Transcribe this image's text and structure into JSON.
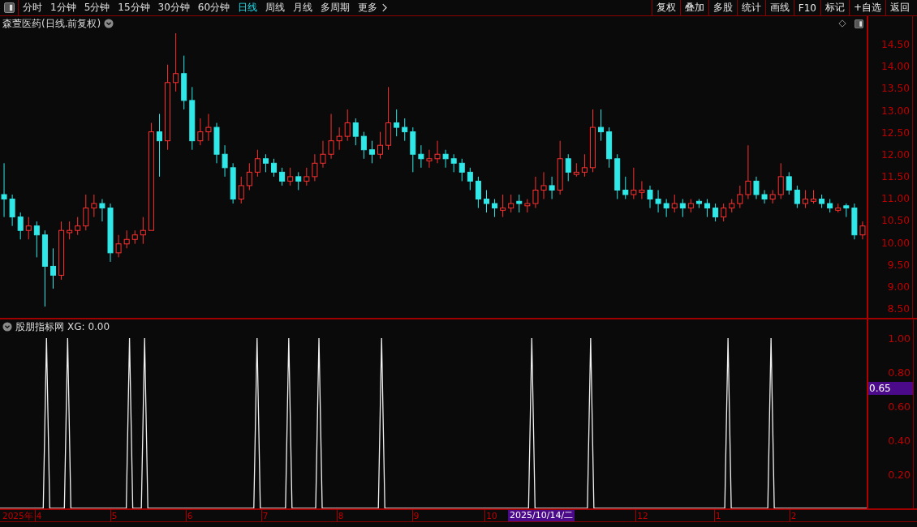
{
  "toolbar": {
    "periods": [
      {
        "label": "分时",
        "selected": false
      },
      {
        "label": "1分钟",
        "selected": false
      },
      {
        "label": "5分钟",
        "selected": false
      },
      {
        "label": "15分钟",
        "selected": false
      },
      {
        "label": "30分钟",
        "selected": false
      },
      {
        "label": "60分钟",
        "selected": false
      },
      {
        "label": "日线",
        "selected": true
      },
      {
        "label": "周线",
        "selected": false
      },
      {
        "label": "月线",
        "selected": false
      },
      {
        "label": "多周期",
        "selected": false
      }
    ],
    "more": "更多",
    "buttons": [
      "复权",
      "叠加",
      "多股",
      "统计",
      "画线",
      "F10",
      "标记",
      "+自选",
      "返回"
    ]
  },
  "price_panel": {
    "title": "森萱医药(日线.前复权)",
    "chart_data": {
      "type": "candlestick",
      "ylim": [
        8.35,
        15.08
      ],
      "yticks": [
        {
          "value": 14.5,
          "label": "14.50"
        },
        {
          "value": 14,
          "label": "14.00"
        },
        {
          "value": 13.5,
          "label": "13.50"
        },
        {
          "value": 13,
          "label": "13.00"
        },
        {
          "value": 12.5,
          "label": "12.50"
        },
        {
          "value": 12,
          "label": "12.00"
        },
        {
          "value": 11.5,
          "label": "11.50"
        },
        {
          "value": 11,
          "label": "11.00"
        },
        {
          "value": 10.5,
          "label": "10.50"
        },
        {
          "value": 10,
          "label": "10.00"
        },
        {
          "value": 9.5,
          "label": "9.50"
        },
        {
          "value": 9,
          "label": "9.00"
        },
        {
          "value": 8.5,
          "label": "8.50"
        }
      ],
      "categories": [
        null,
        null,
        null,
        null,
        null,
        null,
        null,
        null,
        null,
        null,
        null,
        null,
        null,
        null,
        null,
        null,
        null,
        null,
        null,
        null,
        null,
        null,
        null,
        null,
        null,
        null,
        null,
        null,
        null,
        null,
        null,
        null,
        null,
        null,
        null,
        null,
        null,
        null,
        null,
        null,
        null,
        null,
        null,
        null,
        null,
        null,
        null,
        null,
        null,
        null,
        null,
        null,
        null,
        null,
        null,
        null,
        null,
        null,
        null,
        null,
        null,
        null,
        null,
        null,
        null,
        null,
        null,
        null,
        null,
        null,
        null,
        null,
        null,
        null,
        null,
        null,
        null,
        null,
        null,
        null,
        null,
        null,
        null,
        null,
        null,
        null,
        null,
        null,
        null,
        null,
        null,
        null,
        null,
        null,
        null,
        null,
        null,
        null,
        null,
        null,
        null,
        null,
        null,
        null,
        null,
        null
      ],
      "ohlc": [
        [
          11.1,
          11.8,
          10.6,
          11.0
        ],
        [
          11.0,
          11.1,
          10.4,
          10.6
        ],
        [
          10.6,
          10.7,
          10.1,
          10.3
        ],
        [
          10.3,
          10.6,
          10.1,
          10.4
        ],
        [
          10.4,
          10.5,
          9.7,
          10.2
        ],
        [
          10.2,
          10.3,
          8.6,
          9.5
        ],
        [
          9.5,
          9.9,
          9.0,
          9.3
        ],
        [
          9.3,
          10.5,
          9.2,
          10.3
        ],
        [
          10.25,
          10.5,
          10.1,
          10.3
        ],
        [
          10.3,
          10.6,
          10.2,
          10.4
        ],
        [
          10.4,
          11.1,
          10.3,
          10.8
        ],
        [
          10.8,
          11.1,
          10.6,
          10.9
        ],
        [
          10.9,
          11.0,
          10.5,
          10.8
        ],
        [
          10.8,
          10.9,
          9.6,
          9.8
        ],
        [
          9.8,
          10.2,
          9.7,
          10.0
        ],
        [
          10.0,
          10.3,
          9.9,
          10.1
        ],
        [
          10.1,
          10.3,
          10.0,
          10.2
        ],
        [
          10.2,
          10.6,
          10.0,
          10.3
        ],
        [
          10.3,
          12.7,
          10.3,
          12.5
        ],
        [
          12.5,
          12.9,
          11.5,
          12.3
        ],
        [
          12.3,
          14.0,
          12.1,
          13.6
        ],
        [
          13.6,
          14.7,
          13.4,
          13.8
        ],
        [
          13.8,
          14.2,
          13.0,
          13.2
        ],
        [
          13.2,
          13.5,
          12.1,
          12.3
        ],
        [
          12.3,
          12.8,
          12.2,
          12.5
        ],
        [
          12.5,
          12.9,
          12.3,
          12.6
        ],
        [
          12.6,
          12.7,
          11.8,
          12.0
        ],
        [
          12.0,
          12.2,
          11.5,
          11.7
        ],
        [
          11.7,
          11.8,
          10.9,
          11.0
        ],
        [
          11.0,
          11.5,
          10.9,
          11.3
        ],
        [
          11.3,
          11.8,
          11.2,
          11.6
        ],
        [
          11.6,
          12.1,
          11.5,
          11.9
        ],
        [
          11.9,
          12.0,
          11.6,
          11.8
        ],
        [
          11.8,
          11.9,
          11.5,
          11.6
        ],
        [
          11.6,
          11.7,
          11.3,
          11.4
        ],
        [
          11.4,
          11.7,
          11.3,
          11.5
        ],
        [
          11.5,
          11.6,
          11.2,
          11.4
        ],
        [
          11.4,
          11.7,
          11.3,
          11.5
        ],
        [
          11.5,
          12.0,
          11.4,
          11.8
        ],
        [
          11.8,
          12.3,
          11.7,
          12.0
        ],
        [
          12.0,
          12.9,
          11.9,
          12.3
        ],
        [
          12.3,
          12.6,
          12.1,
          12.4
        ],
        [
          12.4,
          13.0,
          12.3,
          12.7
        ],
        [
          12.7,
          12.8,
          12.2,
          12.4
        ],
        [
          12.4,
          12.5,
          11.9,
          12.1
        ],
        [
          12.1,
          12.3,
          11.8,
          12.0
        ],
        [
          12.0,
          12.5,
          11.9,
          12.2
        ],
        [
          12.2,
          13.5,
          12.1,
          12.7
        ],
        [
          12.7,
          13.0,
          12.4,
          12.6
        ],
        [
          12.6,
          12.8,
          12.3,
          12.5
        ],
        [
          12.5,
          12.6,
          11.6,
          12.0
        ],
        [
          12.0,
          12.2,
          11.7,
          11.9
        ],
        [
          11.85,
          12.1,
          11.7,
          11.9
        ],
        [
          11.9,
          12.3,
          11.8,
          12.0
        ],
        [
          12.0,
          12.1,
          11.7,
          11.9
        ],
        [
          11.9,
          12.0,
          11.6,
          11.8
        ],
        [
          11.8,
          11.9,
          11.4,
          11.6
        ],
        [
          11.6,
          11.7,
          11.2,
          11.4
        ],
        [
          11.4,
          11.5,
          10.8,
          11.0
        ],
        [
          11.0,
          11.2,
          10.7,
          10.9
        ],
        [
          10.9,
          11.0,
          10.6,
          10.8
        ],
        [
          10.75,
          11.1,
          10.6,
          10.8
        ],
        [
          10.8,
          11.1,
          10.7,
          10.9
        ],
        [
          10.95,
          11.1,
          10.7,
          10.9
        ],
        [
          10.85,
          11.0,
          10.7,
          10.9
        ],
        [
          10.9,
          11.5,
          10.8,
          11.2
        ],
        [
          11.2,
          11.6,
          11.0,
          11.3
        ],
        [
          11.3,
          11.5,
          11.0,
          11.2
        ],
        [
          11.2,
          12.3,
          11.1,
          11.9
        ],
        [
          11.9,
          12.0,
          11.4,
          11.6
        ],
        [
          11.55,
          11.8,
          11.5,
          11.6
        ],
        [
          11.6,
          12.0,
          11.5,
          11.7
        ],
        [
          11.7,
          13.0,
          11.6,
          12.6
        ],
        [
          12.6,
          13.0,
          12.3,
          12.5
        ],
        [
          12.5,
          12.6,
          11.7,
          11.9
        ],
        [
          11.9,
          12.0,
          11.0,
          11.2
        ],
        [
          11.2,
          11.5,
          11.0,
          11.1
        ],
        [
          11.1,
          11.7,
          11.0,
          11.2
        ],
        [
          11.15,
          11.4,
          11.0,
          11.2
        ],
        [
          11.2,
          11.3,
          10.8,
          11.0
        ],
        [
          11.0,
          11.2,
          10.7,
          10.9
        ],
        [
          10.9,
          11.0,
          10.6,
          10.8
        ],
        [
          10.8,
          11.1,
          10.7,
          10.9
        ],
        [
          10.9,
          11.0,
          10.6,
          10.8
        ],
        [
          10.8,
          11.0,
          10.7,
          10.9
        ],
        [
          10.95,
          11.0,
          10.8,
          10.9
        ],
        [
          10.9,
          11.0,
          10.6,
          10.8
        ],
        [
          10.8,
          10.9,
          10.5,
          10.6
        ],
        [
          10.6,
          10.9,
          10.5,
          10.8
        ],
        [
          10.8,
          11.0,
          10.7,
          10.9
        ],
        [
          10.9,
          11.3,
          10.8,
          11.1
        ],
        [
          11.1,
          12.2,
          11.0,
          11.4
        ],
        [
          11.4,
          11.5,
          11.0,
          11.1
        ],
        [
          11.1,
          11.2,
          10.9,
          11.0
        ],
        [
          11.0,
          11.2,
          10.9,
          11.1
        ],
        [
          11.1,
          11.8,
          11.0,
          11.5
        ],
        [
          11.5,
          11.6,
          11.1,
          11.2
        ],
        [
          11.2,
          11.3,
          10.8,
          10.9
        ],
        [
          10.9,
          11.2,
          10.8,
          11.0
        ],
        [
          10.95,
          11.2,
          10.9,
          11.0
        ],
        [
          11.0,
          11.1,
          10.8,
          10.9
        ],
        [
          10.9,
          11.0,
          10.7,
          10.8
        ],
        [
          10.75,
          10.9,
          10.7,
          10.8
        ],
        [
          10.85,
          10.9,
          10.6,
          10.8
        ],
        [
          10.8,
          10.9,
          10.1,
          10.2
        ],
        [
          10.2,
          10.5,
          10.1,
          10.4
        ]
      ]
    }
  },
  "indicator_panel": {
    "name": "股朋指标网",
    "reading": "XG: 0.00",
    "chart_data": {
      "type": "line",
      "xlim": [
        3.484,
        15.634
      ],
      "ylim": [
        0,
        1.11
      ],
      "x": [
        3.484,
        4.057,
        4.1,
        4.143,
        4.337,
        4.38,
        4.423,
        5.157,
        5.2,
        5.243,
        5.357,
        5.4,
        5.443,
        6.847,
        6.89,
        6.933,
        7.267,
        7.31,
        7.353,
        7.667,
        7.71,
        7.753,
        8.497,
        8.54,
        8.583,
        10.487,
        10.53,
        10.573,
        11.267,
        11.31,
        11.353,
        13.087,
        13.13,
        13.173,
        13.657,
        13.7,
        13.743,
        14.968
      ],
      "values": [
        0,
        0,
        1,
        0,
        0,
        1,
        0,
        0,
        1,
        0,
        0,
        1,
        0,
        0,
        1,
        0,
        0,
        1,
        0,
        0,
        1,
        0,
        0,
        1,
        0,
        0,
        1,
        0,
        0,
        1,
        0,
        0,
        1,
        0,
        0,
        1,
        0,
        0
      ],
      "yticks": [
        {
          "value": 1,
          "label": "1.00"
        },
        {
          "value": 0.8,
          "label": "0.80"
        },
        {
          "value": 0.6,
          "label": "0.60"
        },
        {
          "value": 0.4,
          "label": "0.40"
        },
        {
          "value": 0.2,
          "label": "0.20"
        }
      ],
      "xticks": [
        {
          "value": 4,
          "label": "4"
        },
        {
          "value": 5,
          "label": "5"
        },
        {
          "value": 6,
          "label": "6"
        },
        {
          "value": 7,
          "label": "7"
        },
        {
          "value": 8,
          "label": "8"
        },
        {
          "value": 9,
          "label": "9"
        },
        {
          "value": 10,
          "label": "10"
        },
        {
          "value": 12,
          "label": "12"
        }
      ]
    }
  },
  "cursor": {
    "date": "2025/10/14/二",
    "value": "0.65"
  },
  "time_axis": {
    "year_label": "2025年",
    "next_year_months": [
      "1",
      "2"
    ]
  }
}
